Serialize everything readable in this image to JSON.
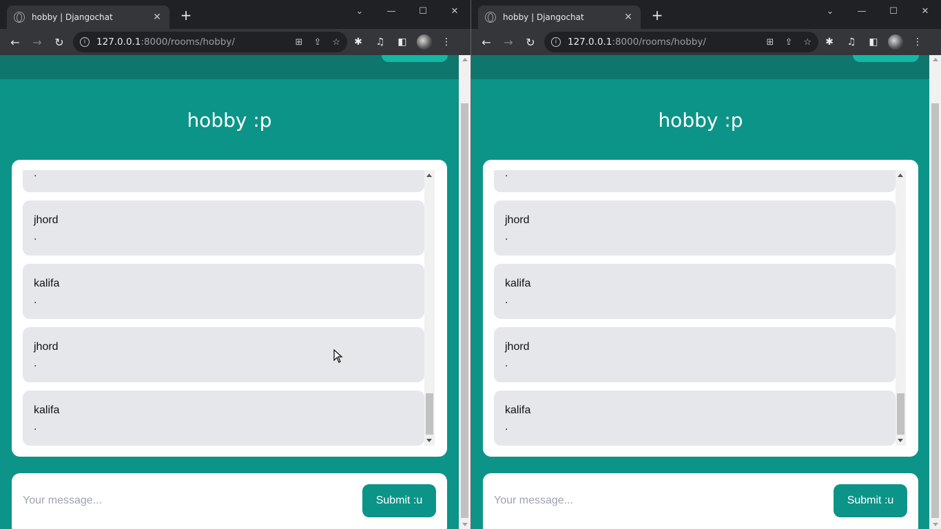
{
  "browser": {
    "tab_title": "hobby | Djangochat",
    "tab_close": "✕",
    "new_tab": "+",
    "url_host": "127.0.0.1",
    "url_path": ":8000/rooms/hobby/"
  },
  "room": {
    "title": "hobby :p"
  },
  "messages": [
    {
      "user": "",
      "text": "."
    },
    {
      "user": "jhord",
      "text": "."
    },
    {
      "user": "kalifa",
      "text": "."
    },
    {
      "user": "jhord",
      "text": "."
    },
    {
      "user": "kalifa",
      "text": "."
    }
  ],
  "form": {
    "placeholder": "Your message...",
    "submit_label": "Submit :u"
  },
  "colors": {
    "teal_bg": "#0d9488",
    "teal_nav": "#0f766e",
    "message_bg": "#e5e7eb"
  }
}
